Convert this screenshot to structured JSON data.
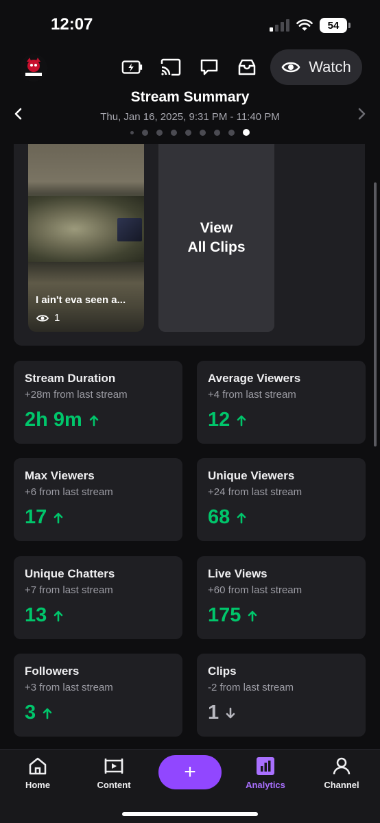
{
  "status_bar": {
    "time": "12:07",
    "battery": "54"
  },
  "header": {
    "watch_label": "Watch"
  },
  "summary": {
    "title": "Stream Summary",
    "date_range": "Thu, Jan 16, 2025, 9:31 PM - 11:40 PM",
    "page_count": 9,
    "active_page": 9
  },
  "clips": {
    "clip_title": "I ain't eva seen a...",
    "clip_views": "1",
    "view_all_line1": "View",
    "view_all_line2": "All Clips"
  },
  "stats": [
    {
      "title": "Stream Duration",
      "sub": "+28m from last stream",
      "value": "2h 9m",
      "trend": "up"
    },
    {
      "title": "Average Viewers",
      "sub": "+4 from last stream",
      "value": "12",
      "trend": "up"
    },
    {
      "title": "Max Viewers",
      "sub": "+6 from last stream",
      "value": "17",
      "trend": "up"
    },
    {
      "title": "Unique Viewers",
      "sub": "+24 from last stream",
      "value": "68",
      "trend": "up"
    },
    {
      "title": "Unique Chatters",
      "sub": "+7 from last stream",
      "value": "13",
      "trend": "up"
    },
    {
      "title": "Live Views",
      "sub": "+60 from last stream",
      "value": "175",
      "trend": "up"
    },
    {
      "title": "Followers",
      "sub": "+3 from last stream",
      "value": "3",
      "trend": "up"
    },
    {
      "title": "Clips",
      "sub": "-2 from last stream",
      "value": "1",
      "trend": "down"
    }
  ],
  "tabs": {
    "home": "Home",
    "content": "Content",
    "create_symbol": "+",
    "analytics": "Analytics",
    "channel": "Channel"
  },
  "colors": {
    "accent": "#9147ff",
    "accent_text": "#a970ff",
    "positive": "#00c66b",
    "card_bg": "#1f1f23",
    "page_bg": "#0e0e10"
  }
}
